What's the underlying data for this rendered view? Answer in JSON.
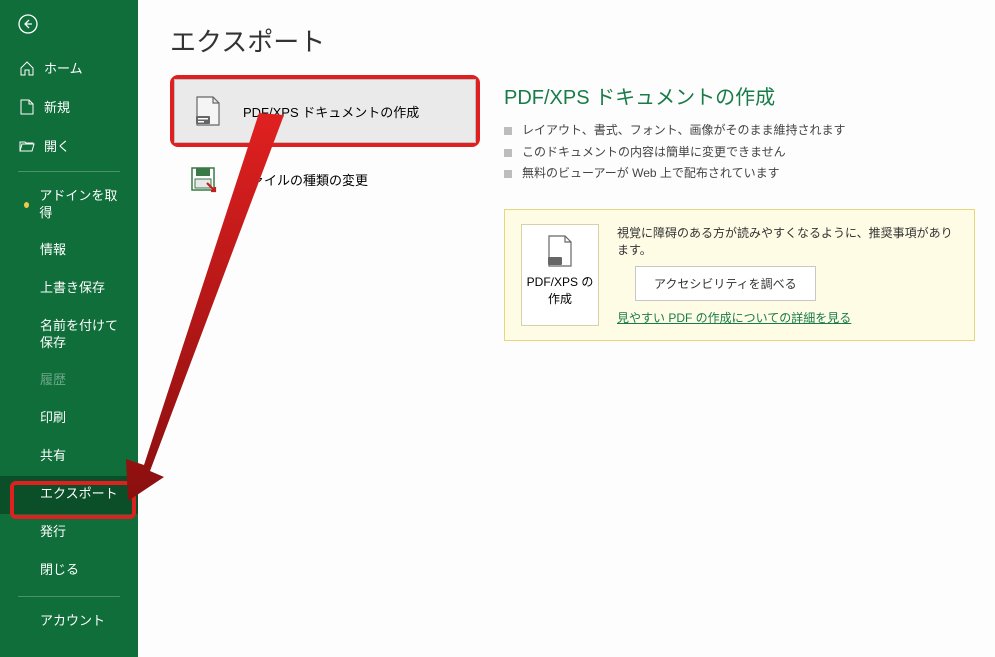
{
  "page_title": "エクスポート",
  "sidebar": {
    "home": "ホーム",
    "new": "新規",
    "open": "開く",
    "get_addins": "アドインを取得",
    "info": "情報",
    "save": "上書き保存",
    "save_as": "名前を付けて保存",
    "history": "履歴",
    "print": "印刷",
    "share": "共有",
    "export": "エクスポート",
    "publish": "発行",
    "close": "閉じる",
    "account": "アカウント"
  },
  "options": {
    "pdf_xps": "PDF/XPS ドキュメントの作成",
    "change_type": "ファイルの種類の変更"
  },
  "detail": {
    "title": "PDF/XPS ドキュメントの作成",
    "bullets": [
      "レイアウト、書式、フォント、画像がそのまま維持されます",
      "このドキュメントの内容は簡単に変更できません",
      "無料のビューアーが Web 上で配布されています"
    ]
  },
  "tip": {
    "big_btn": "PDF/XPS の作成",
    "msg": "視覚に障碍のある方が読みやすくなるように、推奨事項があります。",
    "check_btn": "アクセシビリティを調べる",
    "link": "見やすい PDF の作成についての詳細を見る"
  }
}
